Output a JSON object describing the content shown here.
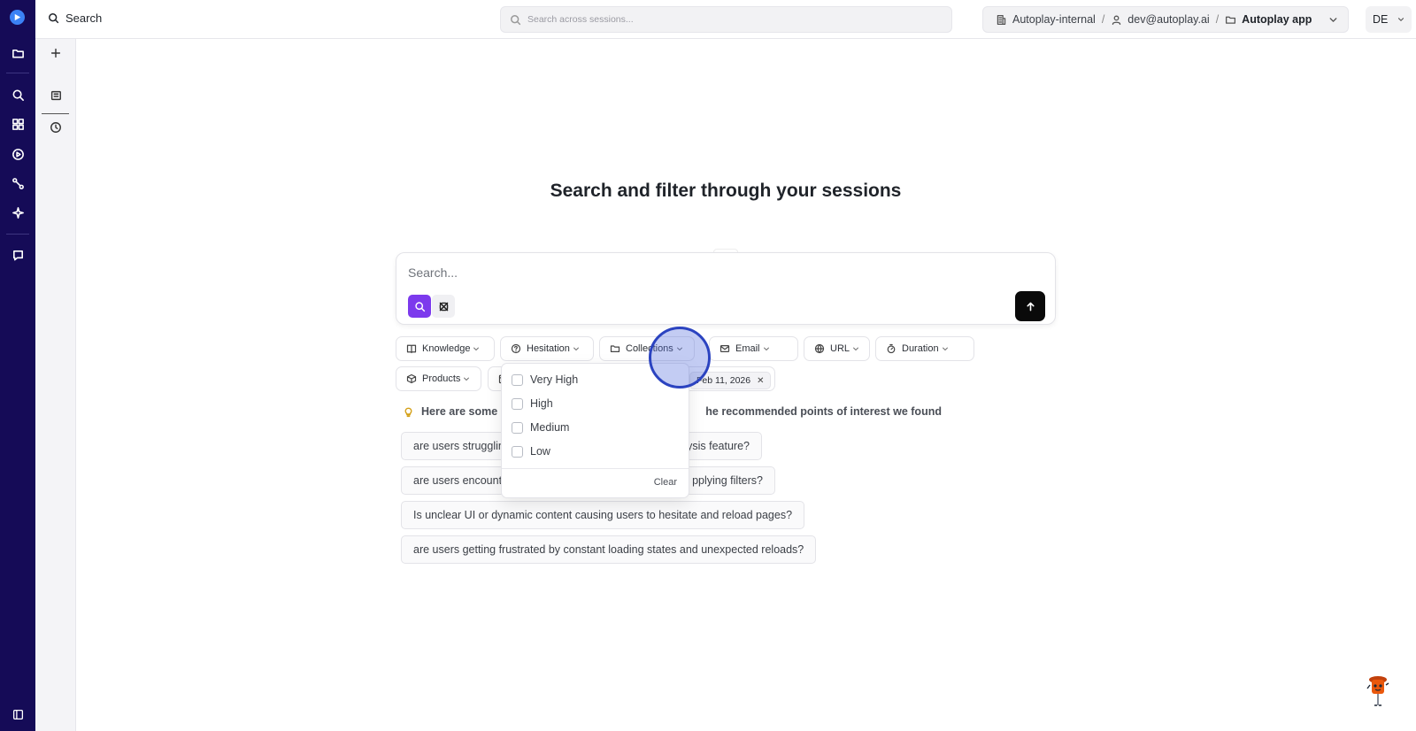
{
  "topbar": {
    "title": "Search",
    "search_placeholder": "Search across sessions...",
    "org": "Autoplay-internal",
    "user": "dev@autoplay.ai",
    "app": "Autoplay app",
    "initials": "DE"
  },
  "rail": {
    "icons": [
      "logo-icon",
      "folder-icon",
      "search-icon",
      "dashboard-icon",
      "play-circle-icon",
      "flows-icon",
      "sparkle-icon",
      "chat-icon",
      "sidebar-collapse-icon"
    ]
  },
  "subnav": {
    "icons": [
      "plus-icon",
      "sessions-icon",
      "history-icon"
    ]
  },
  "main": {
    "heading": "Search and filter through your sessions",
    "search_placeholder": "Search...",
    "filters": [
      {
        "label": "Knowledge",
        "icon": "book-icon"
      },
      {
        "label": "Hesitation",
        "icon": "help-circle-icon"
      },
      {
        "label": "Collections",
        "icon": "folder-icon"
      },
      {
        "label": "Email",
        "icon": "mail-icon"
      },
      {
        "label": "URL",
        "icon": "globe-icon"
      },
      {
        "label": "Duration",
        "icon": "timer-icon"
      },
      {
        "label": "Products",
        "icon": "package-icon"
      }
    ],
    "date_chip": "Feb 11, 2026",
    "tip_start": "Here are some p",
    "tip_end": "he recommended points of interest we found",
    "suggestions": [
      {
        "left": "are users strugglin",
        "right": "ysis feature?"
      },
      {
        "left": "are users encount",
        "right": "pplying filters?"
      },
      {
        "text": "Is unclear UI or dynamic content causing users to hesitate and reload pages?"
      },
      {
        "text": "are users getting frustrated by constant loading states and unexpected reloads?"
      }
    ]
  },
  "dropdown": {
    "options": [
      "Very High",
      "High",
      "Medium",
      "Low"
    ],
    "clear_label": "Clear"
  },
  "colors": {
    "rail_bg": "#150b57",
    "accent": "#7c3aed",
    "send_bg": "#0a0a0a",
    "pointer": "#2b43c0"
  }
}
